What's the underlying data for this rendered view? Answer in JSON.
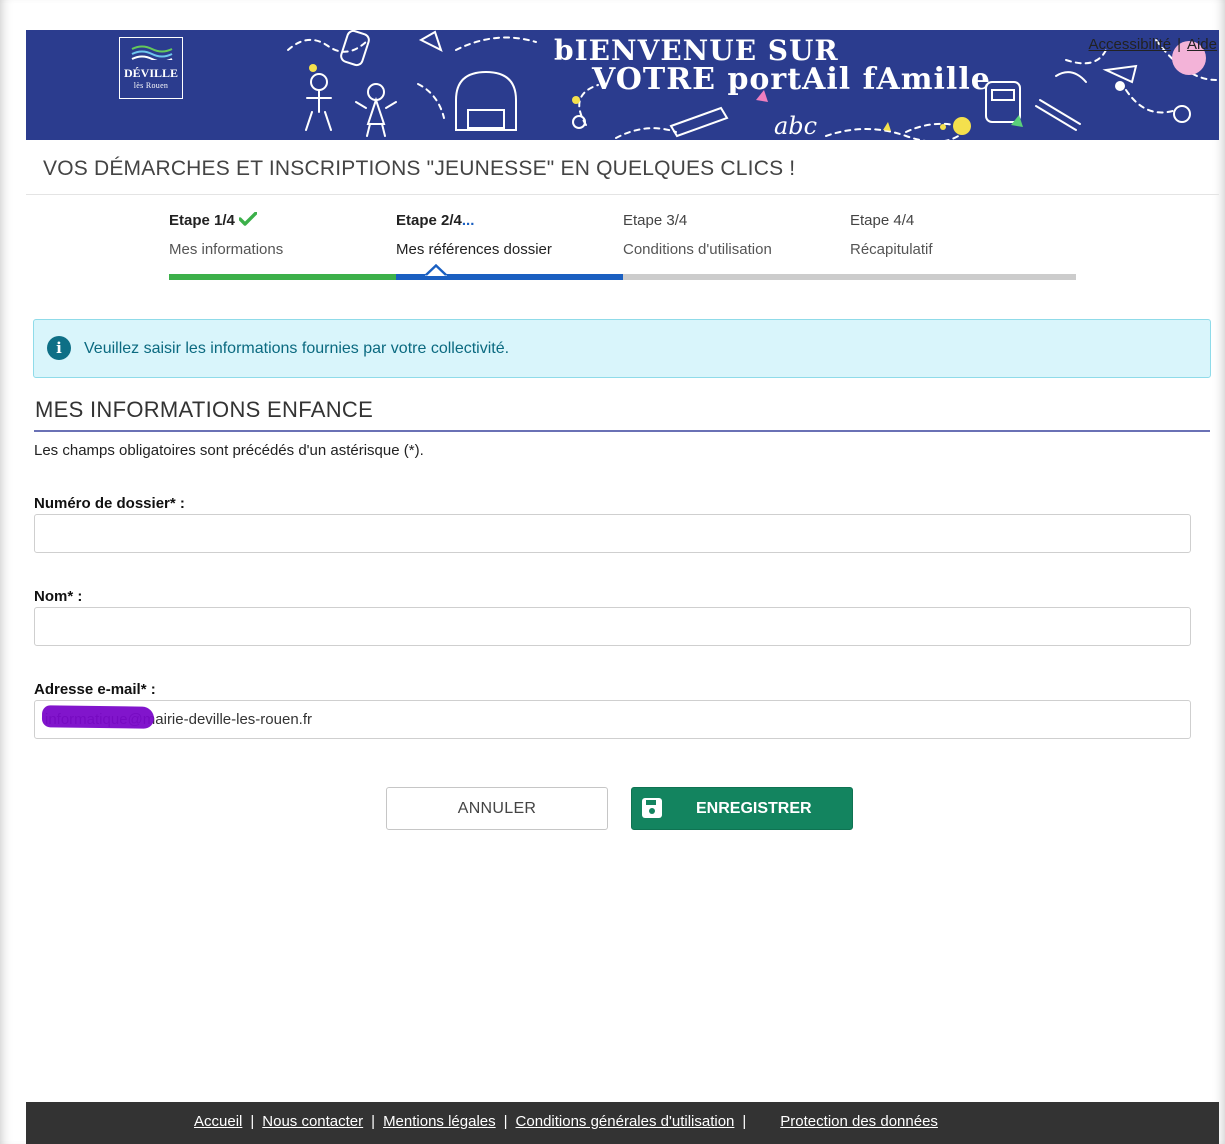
{
  "header": {
    "logo_line1": "DÉVILLE",
    "logo_line2": "lès Rouen",
    "banner_line1": "bIENVENUE SUR",
    "banner_line2": "VOTRE portAil fAmille",
    "links": [
      "Accessibilité",
      "Aide"
    ],
    "link_separator": "|"
  },
  "tagline": "VOS DÉMARCHES ET INSCRIPTIONS \"JEUNESSE\" EN QUELQUES CLICS !",
  "stepper": {
    "steps": [
      {
        "title": "Etape 1/4",
        "subtitle": "Mes informations",
        "status": "done"
      },
      {
        "title": "Etape 2/4",
        "subtitle": "Mes références dossier",
        "status": "active"
      },
      {
        "title": "Etape 3/4",
        "subtitle": "Conditions d'utilisation",
        "status": "pending"
      },
      {
        "title": "Etape 4/4",
        "subtitle": "Récapitulatif",
        "status": "pending"
      }
    ],
    "active_suffix": "...",
    "colors": {
      "done": "#3cb04a",
      "active": "#1a5fc1",
      "pending": "#cccccc"
    }
  },
  "alert": {
    "icon": "info-icon",
    "message": "Veuillez saisir les informations fournies par votre collectivité."
  },
  "section": {
    "title": "MES INFORMATIONS ENFANCE",
    "required_note": "Les champs obligatoires sont précédés d'un astérisque (*)."
  },
  "form": {
    "file_number": {
      "label": "Numéro de dossier* :",
      "value": ""
    },
    "name": {
      "label": "Nom* :",
      "value": ""
    },
    "email": {
      "label": "Adresse e-mail* :",
      "value": "informatique@mairie-deville-les-rouen.fr"
    }
  },
  "buttons": {
    "cancel": "ANNULER",
    "save": "ENREGISTRER",
    "save_icon": "floppy-disk-icon"
  },
  "footer": {
    "links": [
      "Accueil",
      "Nous contacter",
      "Mentions légales",
      "Conditions générales d'utilisation",
      "Protection des données"
    ]
  }
}
